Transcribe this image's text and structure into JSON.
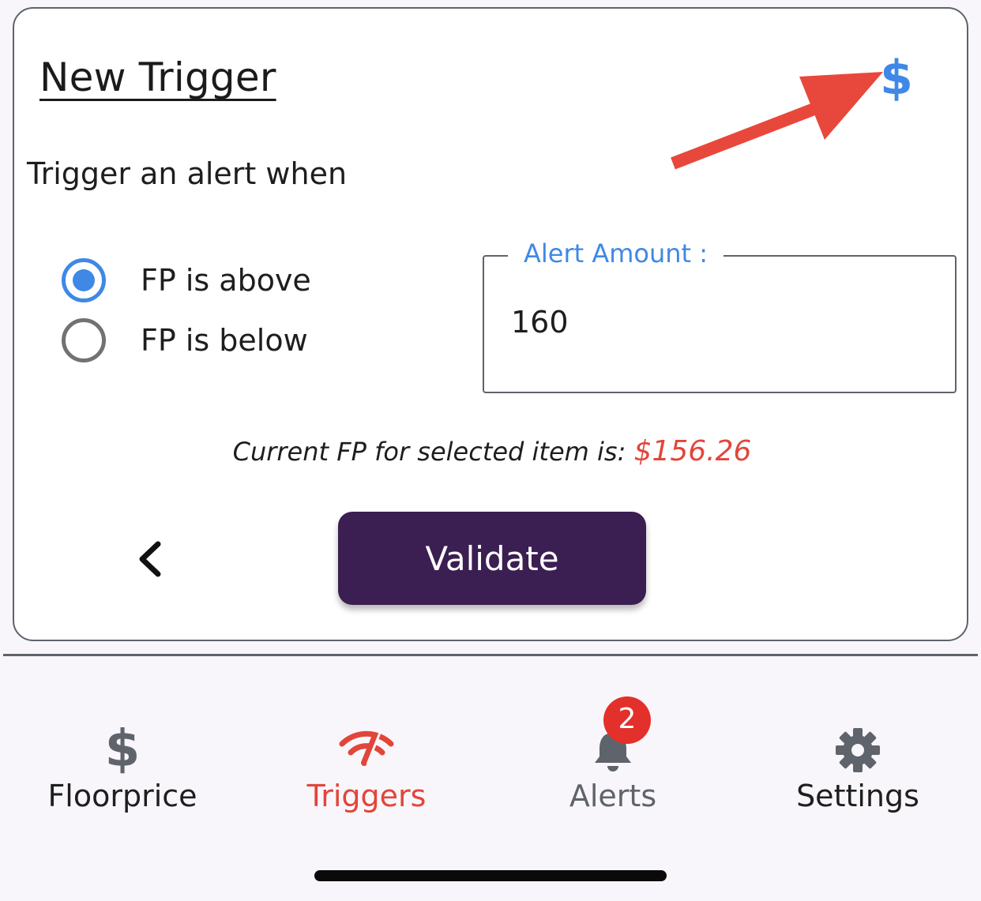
{
  "card": {
    "title": "New Trigger",
    "subtitle": "Trigger an alert when"
  },
  "radios": [
    {
      "label": "FP is above",
      "selected": true
    },
    {
      "label": "FP is below",
      "selected": false
    }
  ],
  "alert_amount": {
    "legend": "Alert Amount :",
    "value": "160"
  },
  "current_fp": {
    "text": "Current FP for selected item is: ",
    "price": "$156.26"
  },
  "buttons": {
    "validate_label": "Validate"
  },
  "tabs": [
    {
      "label": "Floorprice",
      "icon": "dollar-icon"
    },
    {
      "label": "Triggers",
      "icon": "triggers-icon",
      "active": true
    },
    {
      "label": "Alerts",
      "icon": "bell-icon",
      "badge": "2"
    },
    {
      "label": "Settings",
      "icon": "gear-icon"
    }
  ],
  "colors": {
    "accent_blue": "#3f88e6",
    "price_red": "#e2453a",
    "validate_bg": "#3b1e52",
    "badge_red": "#e3302a",
    "arrow_red": "#e8483b"
  }
}
